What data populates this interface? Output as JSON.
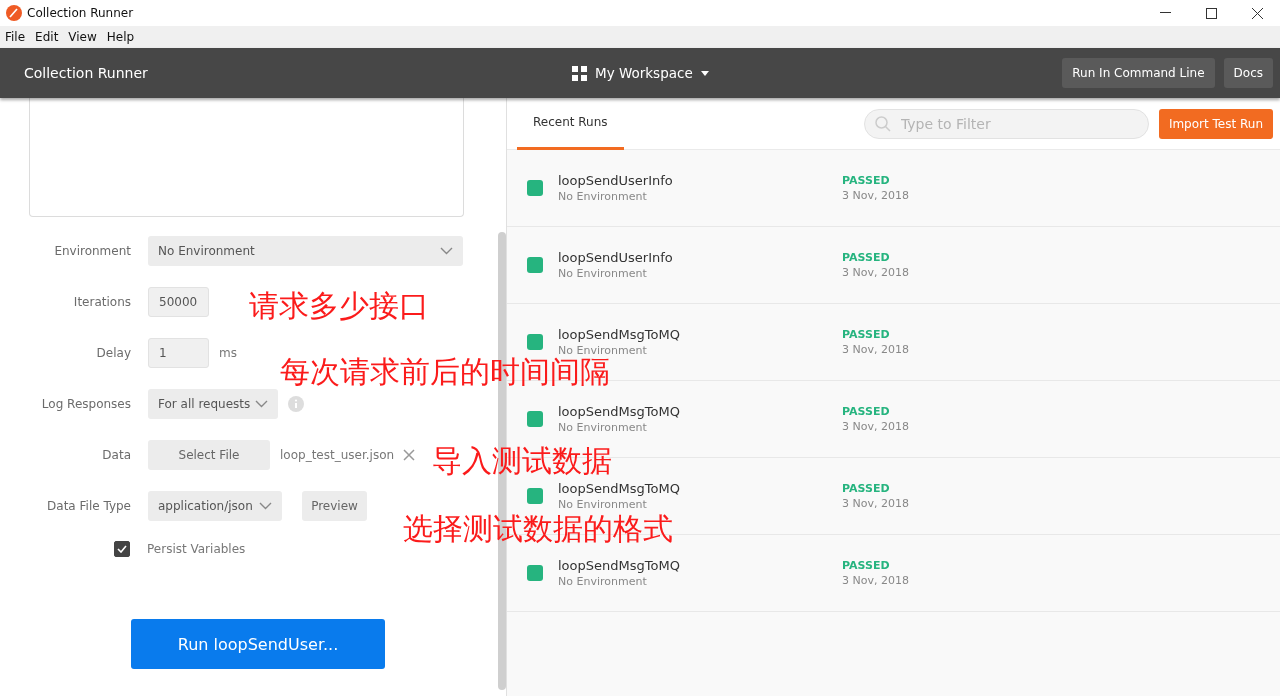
{
  "window": {
    "title": "Collection Runner"
  },
  "menu": [
    "File",
    "Edit",
    "View",
    "Help"
  ],
  "header": {
    "title": "Collection Runner",
    "workspace": "My Workspace",
    "buttons": [
      "Run In Command Line",
      "Docs"
    ]
  },
  "form": {
    "environment": {
      "label": "Environment",
      "value": "No Environment"
    },
    "iterations": {
      "label": "Iterations",
      "value": "50000"
    },
    "delay": {
      "label": "Delay",
      "value": "1",
      "unit": "ms"
    },
    "log_responses": {
      "label": "Log Responses",
      "value": "For all requests"
    },
    "data": {
      "label": "Data",
      "button": "Select File",
      "file": "loop_test_user.json"
    },
    "data_file_type": {
      "label": "Data File Type",
      "value": "application/json",
      "button": "Preview"
    },
    "persist_variables": {
      "label": "Persist Variables",
      "checked": true
    },
    "run_button": "Run loopSendUser..."
  },
  "tabs": [
    {
      "label": "Recent Runs",
      "selected": true
    }
  ],
  "filter": {
    "placeholder": "Type to Filter"
  },
  "import_button": "Import Test Run",
  "runs": [
    {
      "name": "loopSendUserInfo",
      "environment": "No Environment",
      "status": "PASSED",
      "date": "3 Nov, 2018",
      "color": "#26b47f"
    },
    {
      "name": "loopSendUserInfo",
      "environment": "No Environment",
      "status": "PASSED",
      "date": "3 Nov, 2018",
      "color": "#26b47f"
    },
    {
      "name": "loopSendMsgToMQ",
      "environment": "No Environment",
      "status": "PASSED",
      "date": "3 Nov, 2018",
      "color": "#26b47f"
    },
    {
      "name": "loopSendMsgToMQ",
      "environment": "No Environment",
      "status": "PASSED",
      "date": "3 Nov, 2018",
      "color": "#26b47f"
    },
    {
      "name": "loopSendMsgToMQ",
      "environment": "No Environment",
      "status": "PASSED",
      "date": "3 Nov, 2018",
      "color": "#26b47f"
    },
    {
      "name": "loopSendMsgToMQ",
      "environment": "No Environment",
      "status": "PASSED",
      "date": "3 Nov, 2018",
      "color": "#26b47f"
    }
  ],
  "annotations": [
    "请求多少接口",
    "每次请求前后的时间间隔",
    "导入测试数据",
    "选择测试数据的格式"
  ]
}
